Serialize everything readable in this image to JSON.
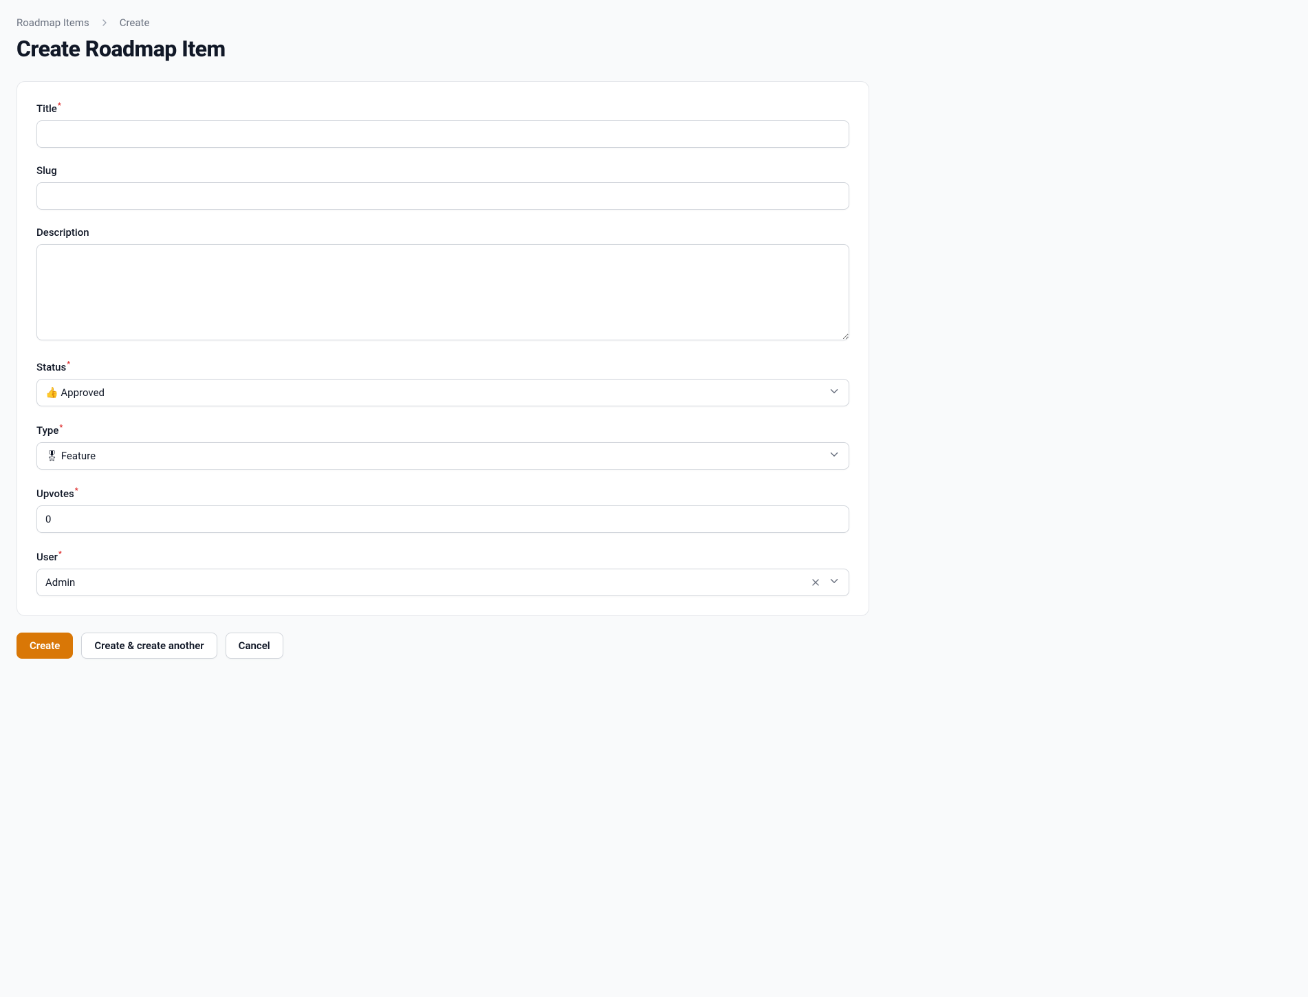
{
  "breadcrumb": {
    "parent": "Roadmap Items",
    "current": "Create"
  },
  "page": {
    "title": "Create Roadmap Item"
  },
  "form": {
    "title": {
      "label": "Title",
      "value": ""
    },
    "slug": {
      "label": "Slug",
      "value": ""
    },
    "description": {
      "label": "Description",
      "value": ""
    },
    "status": {
      "label": "Status",
      "value": "👍 Approved"
    },
    "type": {
      "label": "Type",
      "value": "🎖 Feature"
    },
    "upvotes": {
      "label": "Upvotes",
      "value": "0"
    },
    "user": {
      "label": "User",
      "value": "Admin"
    }
  },
  "buttons": {
    "create": "Create",
    "create_another": "Create & create another",
    "cancel": "Cancel"
  }
}
